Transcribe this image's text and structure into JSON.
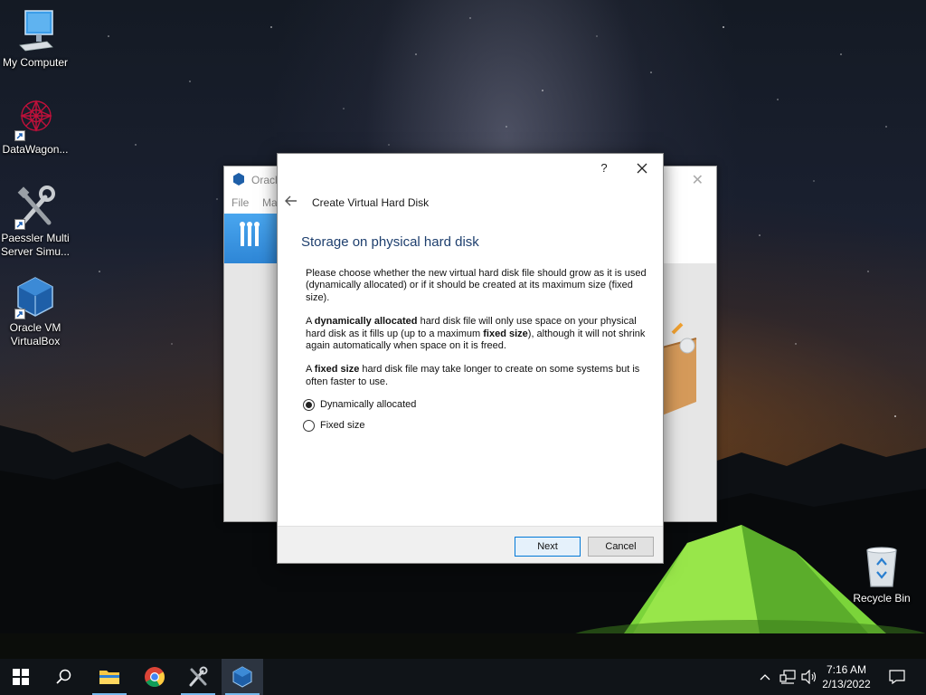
{
  "desktop": {
    "icons": [
      {
        "label": "My Computer"
      },
      {
        "label": "DataWagon..."
      },
      {
        "label": "Paessler Multi Server Simu..."
      },
      {
        "label": "Oracle VM VirtualBox"
      },
      {
        "label": "Recycle Bin"
      }
    ]
  },
  "bg_window": {
    "title": "Oracl",
    "menu": {
      "file": "File",
      "machine": "Ma"
    }
  },
  "dialog": {
    "heading": "Create Virtual Hard Disk",
    "help": "?",
    "subtitle": "Storage on physical hard disk",
    "para1": "Please choose whether the new virtual hard disk file should grow as it is used (dynamically allocated) or if it should be created at its maximum size (fixed size).",
    "para2": {
      "a": "A ",
      "b1": "dynamically allocated",
      "c": " hard disk file will only use space on your physical hard disk as it fills up (up to a maximum ",
      "b2": "fixed size",
      "d": "), although it will not shrink again automatically when space on it is freed."
    },
    "para3": {
      "a": "A ",
      "b1": "fixed size",
      "c": " hard disk file may take longer to create on some systems but is often faster to use."
    },
    "options": [
      {
        "label": "Dynamically allocated",
        "checked": true
      },
      {
        "label": "Fixed size",
        "checked": false
      }
    ],
    "buttons": {
      "next": "Next",
      "cancel": "Cancel"
    }
  },
  "taskbar": {
    "time": "7:16 AM",
    "date": "2/13/2022"
  },
  "colors": {
    "accent": "#0078d7",
    "subtitle": "#1e3f6e",
    "taskbar": "#101418"
  }
}
